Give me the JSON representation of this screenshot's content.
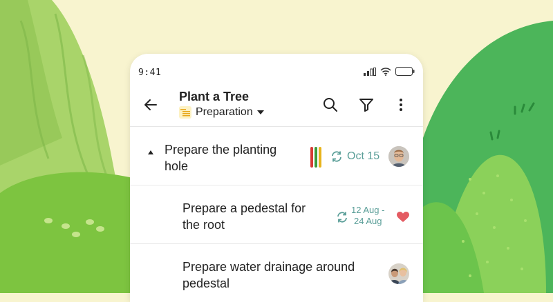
{
  "status_bar": {
    "time": "9:41"
  },
  "header": {
    "title": "Plant a Tree",
    "section": "Preparation"
  },
  "icons": {
    "back": "arrow-left-icon",
    "search": "search-icon",
    "filter": "filter-icon",
    "more": "more-vertical-icon",
    "section": "list-icon"
  },
  "colors": {
    "accent": "#5a9e98",
    "bar_red": "#d63a35",
    "bar_green": "#3c9a3c",
    "bar_yellow": "#e8b41c",
    "heart": "#e45b62"
  },
  "tasks": [
    {
      "title_line1": "Prepare the planting",
      "title_line2": "hole",
      "date": "Oct 15"
    },
    {
      "title_line1": "Prepare a pedestal for",
      "title_line2": "the root",
      "date_start": "12 Aug -",
      "date_end": "24 Aug"
    },
    {
      "title_line1": "Prepare water drainage around",
      "title_line2": "pedestal"
    }
  ]
}
